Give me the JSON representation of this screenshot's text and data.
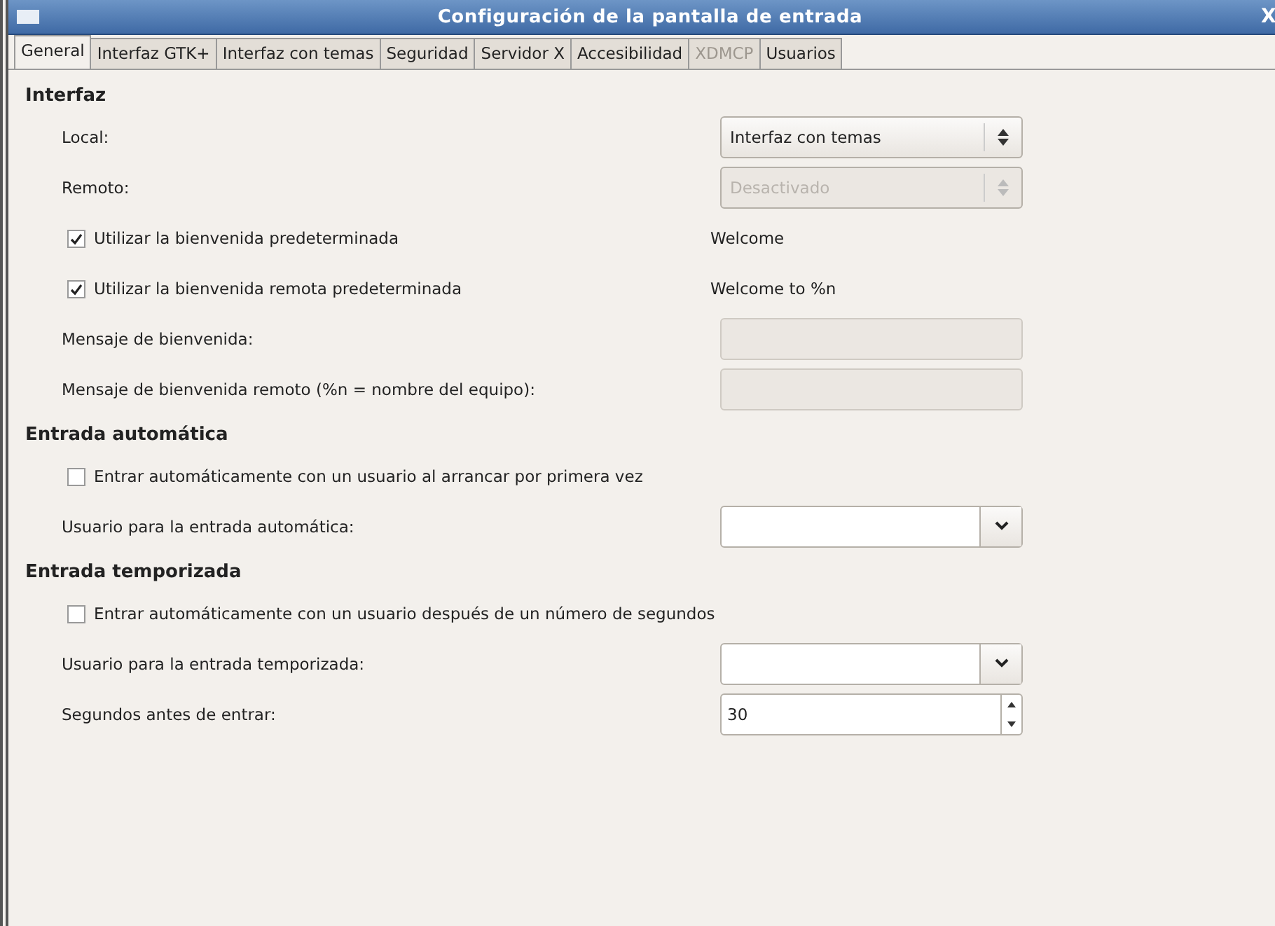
{
  "window": {
    "title": "Configuración de la pantalla de entrada",
    "close": "X"
  },
  "tabs": [
    {
      "label": "General",
      "selected": true,
      "disabled": false
    },
    {
      "label": "Interfaz GTK+",
      "selected": false,
      "disabled": false
    },
    {
      "label": "Interfaz con temas",
      "selected": false,
      "disabled": false
    },
    {
      "label": "Seguridad",
      "selected": false,
      "disabled": false
    },
    {
      "label": "Servidor X",
      "selected": false,
      "disabled": false
    },
    {
      "label": "Accesibilidad",
      "selected": false,
      "disabled": false
    },
    {
      "label": "XDMCP",
      "selected": false,
      "disabled": true
    },
    {
      "label": "Usuarios",
      "selected": false,
      "disabled": false
    }
  ],
  "sections": [
    {
      "title": "Interfaz",
      "rows": [
        {
          "kind": "select",
          "label": "Local:",
          "value": "Interfaz con temas",
          "disabled": false
        },
        {
          "kind": "select",
          "label": "Remoto:",
          "value": "Desactivado",
          "disabled": true
        },
        {
          "kind": "check",
          "label": "Utilizar la bienvenida predeterminada",
          "checked": true,
          "value": "Welcome"
        },
        {
          "kind": "check",
          "label": "Utilizar la bienvenida remota predeterminada",
          "checked": true,
          "value": "Welcome to %n"
        },
        {
          "kind": "entry",
          "label": "Mensaje de bienvenida:",
          "disabled": true
        },
        {
          "kind": "entry",
          "label": "Mensaje de bienvenida remoto (%n = nombre del equipo):",
          "disabled": true
        }
      ]
    },
    {
      "title": "Entrada automática",
      "rows": [
        {
          "kind": "check",
          "label": "Entrar automáticamente con un usuario al arrancar por primera vez",
          "checked": false
        },
        {
          "kind": "combo",
          "label": "Usuario para la entrada automática:"
        }
      ]
    },
    {
      "title": "Entrada temporizada",
      "rows": [
        {
          "kind": "check",
          "label": "Entrar automáticamente con un usuario después de un número de segundos",
          "checked": false
        },
        {
          "kind": "combo",
          "label": "Usuario para la entrada temporizada:"
        },
        {
          "kind": "spin",
          "label": "Segundos antes de entrar:",
          "value": "30"
        }
      ]
    }
  ]
}
